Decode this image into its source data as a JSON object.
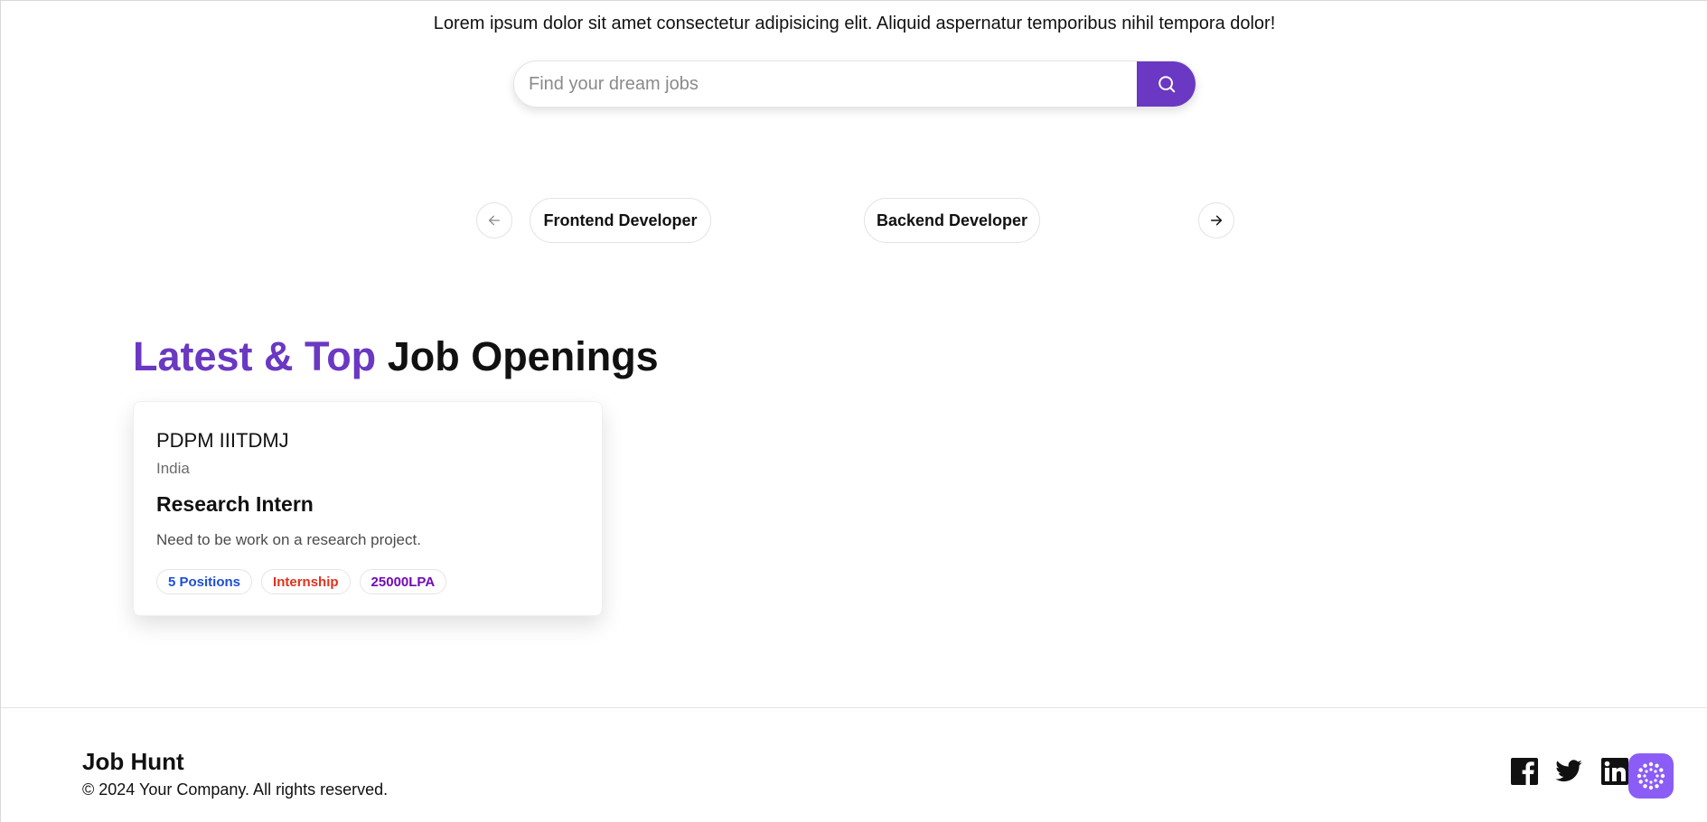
{
  "hero": {
    "tagline": "Lorem ipsum dolor sit amet consectetur adipisicing elit. Aliquid aspernatur temporibus nihil tempora dolor!"
  },
  "search": {
    "placeholder": "Find your dream jobs",
    "value": "",
    "button_icon": "search-icon"
  },
  "categories": {
    "prev_icon": "arrow-left-icon",
    "next_icon": "arrow-right-icon",
    "items": [
      {
        "label": "Frontend Developer"
      },
      {
        "label": "Backend Developer"
      }
    ]
  },
  "section": {
    "title_accent": "Latest & Top",
    "title_rest": "Job Openings"
  },
  "jobs": [
    {
      "company": "PDPM IIITDMJ",
      "location": "India",
      "title": "Research Intern",
      "description": "Need to be work on a research project.",
      "positions": "5 Positions",
      "job_type": "Internship",
      "salary": "25000LPA"
    }
  ],
  "footer": {
    "brand": "Job Hunt",
    "copyright": "© 2024 Your Company. All rights reserved.",
    "social_icons": [
      "facebook-icon",
      "twitter-icon",
      "linkedin-icon"
    ],
    "fab_icon": "assistant-icon"
  },
  "colors": {
    "accent": "#6a38c2",
    "badge_blue": "#1d4ed8",
    "badge_red": "#e0321c",
    "badge_purple": "#7209b7",
    "fab": "#8b5cf6"
  }
}
